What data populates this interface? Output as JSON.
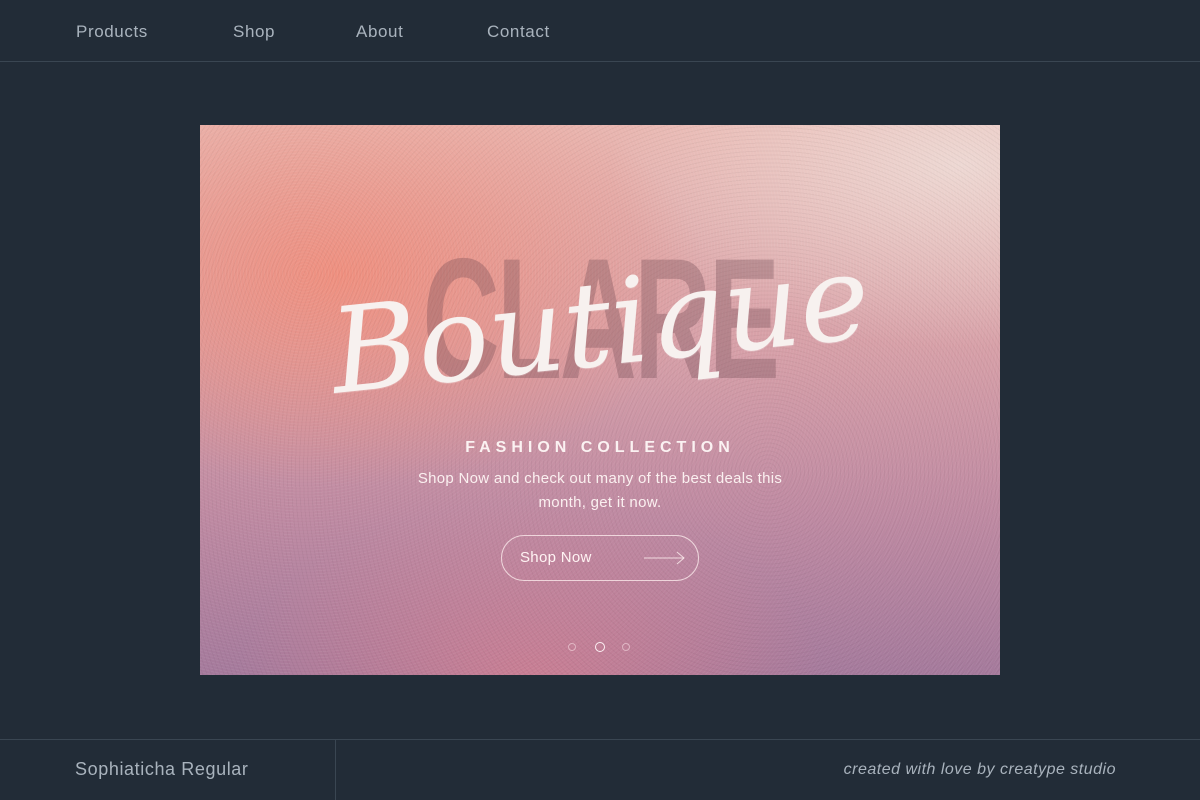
{
  "nav": {
    "items": [
      {
        "label": "Products"
      },
      {
        "label": "Shop"
      },
      {
        "label": "About"
      },
      {
        "label": "Contact"
      }
    ]
  },
  "hero": {
    "background_word": "CLARE",
    "script_title": "Boutique",
    "subtitle": "FASHION COLLECTION",
    "description": "Shop Now and check out many of the best deals this month, get it now.",
    "cta_label": "Shop Now",
    "cta_icon": "arrow-right-icon",
    "slider": {
      "count": 3,
      "active_index": 1
    }
  },
  "footer": {
    "font_name": "Sophiaticha Regular",
    "credit": "created with love by creatype studio"
  },
  "colors": {
    "background": "#222c37",
    "nav_text": "#a9b3bd",
    "divider": "#3a4652",
    "hero_light": "#f7f1ef"
  }
}
